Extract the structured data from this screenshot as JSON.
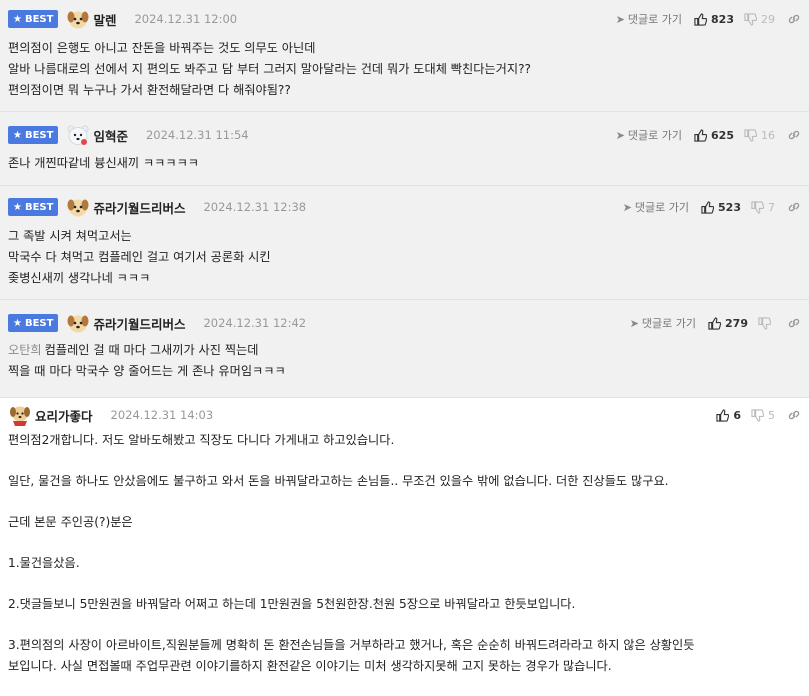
{
  "badge_label": "BEST",
  "reply_label": "댓글로 가기",
  "best_comments": [
    {
      "nickname": "말렌",
      "avatar": "puppy-avatar",
      "date": "2024.12.31 12:00",
      "up": "823",
      "down": "29",
      "lines": [
        "편의점이 은행도 아니고 잔돈을 바꿔주는 것도 의무도 아닌데",
        "알바 나름대로의 선에서 지 편의도 봐주고 담 부터 그러지 말아달라는 건데 뭐가 도대체 빡친다는거지??",
        "편의점이면 뭐 누구나 가서 환전해달라면 다 해줘야됨??"
      ]
    },
    {
      "nickname": "임혁준",
      "avatar": "polar-bear-avatar",
      "date": "2024.12.31 11:54",
      "up": "625",
      "down": "16",
      "lines": [
        "존나 개찐따같네 븅신새끼 ㅋㅋㅋㅋㅋ"
      ]
    },
    {
      "nickname": "쥬라기월드리버스",
      "avatar": "puppy-avatar",
      "date": "2024.12.31 12:38",
      "up": "523",
      "down": "7",
      "lines": [
        "그 족발 시켜 쳐먹고서는",
        "막국수 다 쳐먹고 컴플레인 걸고 여기서 공론화 시킨",
        "좆병신새끼 생각나네 ㅋㅋㅋ"
      ]
    },
    {
      "nickname": "쥬라기월드리버스",
      "avatar": "puppy-avatar",
      "date": "2024.12.31 12:42",
      "up": "279",
      "down": "",
      "mention": "오탄희",
      "lines": [
        "컴플레인 걸 때 마다 그새끼가 사진 찍는데",
        "찍을 때 마다 막국수 양 줄어드는 게 존나 유머임ㅋㅋㅋ"
      ]
    }
  ],
  "normal_comment": {
    "nickname": "요리가좋다",
    "avatar": "dog-cook-avatar",
    "date": "2024.12.31 14:03",
    "up": "6",
    "down": "5",
    "paragraphs": [
      "편의점2개합니다. 저도 알바도해봤고 직장도 다니다 가게내고 하고있습니다.",
      "일단, 물건을 하나도 안샀음에도 불구하고 와서 돈을 바꿔달라고하는 손님들.. 무조건 있을수 밖에 없습니다. 더한 진상들도 많구요.",
      "근데 본문 주인공(?)분은",
      "1.물건을샀음.",
      "2.댓글들보니 5만원권을 바꿔달라 어쩌고 하는데 1만원권을 5천원한장.천원 5장으로 바꿔달라고 한듯보입니다.",
      "3.편의점의 사장이 아르바이트,직원분들께 명확히 돈 환전손님들을 거부하라고 했거나, 혹은 순순히 바꿔드려라라고 하지 않은 상황인듯",
      "보입니다. 사실 면접볼때 주업무관련 이야기를하지 환전같은 이야기는 미처 생각하지못해 고지 못하는 경우가 많습니다."
    ]
  },
  "colors": {
    "badge": "#4a7ae0",
    "best_bg": "#f1f1f1",
    "mention": "#8a8a8a"
  }
}
